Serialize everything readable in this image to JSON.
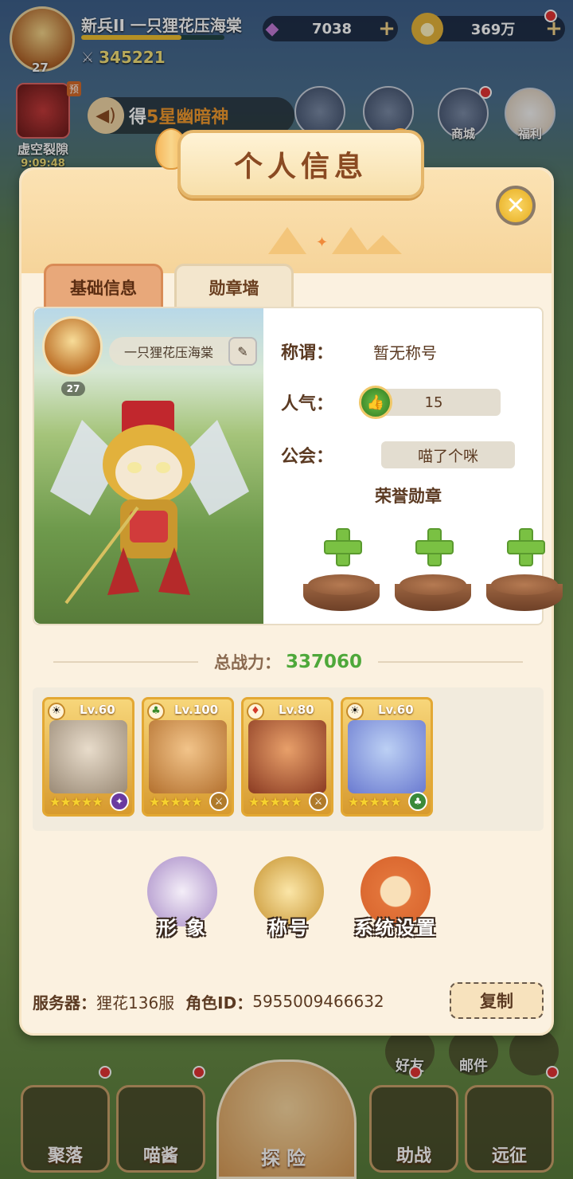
{
  "topbar": {
    "player_name": "新兵II 一只狸花压海棠",
    "level": "27",
    "combat_power": "345221",
    "gems": "7038",
    "gold": "369万"
  },
  "event": {
    "label": "虚空裂隙",
    "tag": "预",
    "timer": "9:09:48"
  },
  "marquee": {
    "prefix": "得",
    "highlight": "5星幽暗神"
  },
  "top_icons": [
    {
      "label": "商城"
    },
    {
      "label": "福利"
    }
  ],
  "side_buttons": [
    {
      "label": "好友"
    },
    {
      "label": "邮件"
    }
  ],
  "bottom_nav": [
    {
      "label": "聚落"
    },
    {
      "label": "喵酱"
    },
    {
      "label": "探险"
    },
    {
      "label": "助战"
    },
    {
      "label": "远征"
    }
  ],
  "dialog": {
    "title": "个人信息",
    "close_icon": "close-x",
    "tabs": [
      {
        "label": "基础信息",
        "active": true
      },
      {
        "label": "勋章墙",
        "active": false
      }
    ],
    "profile": {
      "name": "一只狸花压海棠",
      "level": "27"
    },
    "info": {
      "title_key": "称谓：",
      "title_value": "暂无称号",
      "popularity_key": "人气：",
      "popularity_value": "15",
      "guild_key": "公会：",
      "guild_value": "喵了个咪",
      "honor_label": "荣誉勋章"
    },
    "total_power": {
      "label": "总战力：",
      "value": "337060"
    },
    "team": [
      {
        "level": "Lv.60",
        "element": "sun",
        "stars": 5,
        "class": "mage",
        "color": "#d8c2a6"
      },
      {
        "level": "Lv.100",
        "element": "tree",
        "stars": 5,
        "class": "warrior",
        "color": "#e6a25a"
      },
      {
        "level": "Lv.80",
        "element": "fire",
        "stars": 5,
        "class": "warrior",
        "color": "#c76a3a"
      },
      {
        "level": "Lv.60",
        "element": "sun",
        "stars": 5,
        "class": "nature",
        "color": "#8aa6e6"
      }
    ],
    "actions": [
      {
        "label": "形 象",
        "icon": "mask-icon"
      },
      {
        "label": "称号",
        "icon": "title-badge-icon"
      },
      {
        "label": "系统设置",
        "icon": "gear-icon"
      }
    ],
    "footer": {
      "server_key": "服务器：",
      "server_value": "狸花136服",
      "role_key": "角色ID：",
      "role_value": "5955009466632",
      "copy_label": "复制"
    }
  },
  "colors": {
    "dialog_bg": "#fbf1e0",
    "power_green": "#4ea83a",
    "tab_active": "#e8a87a",
    "title_brown": "#8a4a22"
  }
}
